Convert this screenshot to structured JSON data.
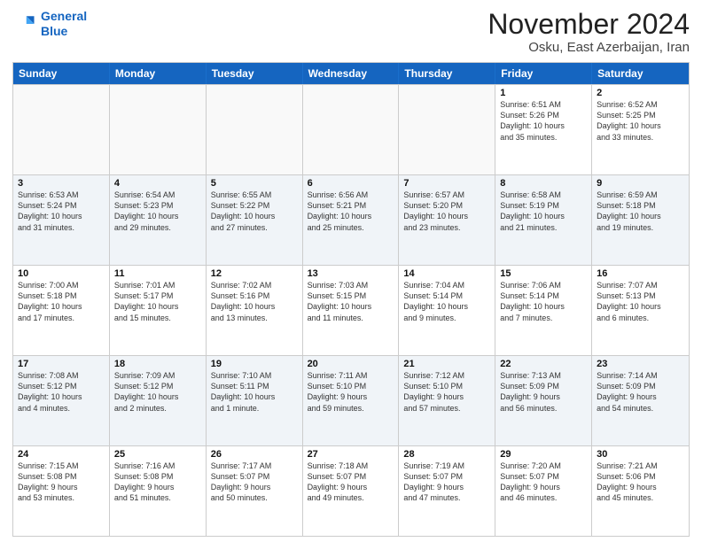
{
  "header": {
    "logo_line1": "General",
    "logo_line2": "Blue",
    "month_title": "November 2024",
    "location": "Osku, East Azerbaijan, Iran"
  },
  "weekdays": [
    "Sunday",
    "Monday",
    "Tuesday",
    "Wednesday",
    "Thursday",
    "Friday",
    "Saturday"
  ],
  "rows": [
    [
      {
        "day": "",
        "info": ""
      },
      {
        "day": "",
        "info": ""
      },
      {
        "day": "",
        "info": ""
      },
      {
        "day": "",
        "info": ""
      },
      {
        "day": "",
        "info": ""
      },
      {
        "day": "1",
        "info": "Sunrise: 6:51 AM\nSunset: 5:26 PM\nDaylight: 10 hours\nand 35 minutes."
      },
      {
        "day": "2",
        "info": "Sunrise: 6:52 AM\nSunset: 5:25 PM\nDaylight: 10 hours\nand 33 minutes."
      }
    ],
    [
      {
        "day": "3",
        "info": "Sunrise: 6:53 AM\nSunset: 5:24 PM\nDaylight: 10 hours\nand 31 minutes."
      },
      {
        "day": "4",
        "info": "Sunrise: 6:54 AM\nSunset: 5:23 PM\nDaylight: 10 hours\nand 29 minutes."
      },
      {
        "day": "5",
        "info": "Sunrise: 6:55 AM\nSunset: 5:22 PM\nDaylight: 10 hours\nand 27 minutes."
      },
      {
        "day": "6",
        "info": "Sunrise: 6:56 AM\nSunset: 5:21 PM\nDaylight: 10 hours\nand 25 minutes."
      },
      {
        "day": "7",
        "info": "Sunrise: 6:57 AM\nSunset: 5:20 PM\nDaylight: 10 hours\nand 23 minutes."
      },
      {
        "day": "8",
        "info": "Sunrise: 6:58 AM\nSunset: 5:19 PM\nDaylight: 10 hours\nand 21 minutes."
      },
      {
        "day": "9",
        "info": "Sunrise: 6:59 AM\nSunset: 5:18 PM\nDaylight: 10 hours\nand 19 minutes."
      }
    ],
    [
      {
        "day": "10",
        "info": "Sunrise: 7:00 AM\nSunset: 5:18 PM\nDaylight: 10 hours\nand 17 minutes."
      },
      {
        "day": "11",
        "info": "Sunrise: 7:01 AM\nSunset: 5:17 PM\nDaylight: 10 hours\nand 15 minutes."
      },
      {
        "day": "12",
        "info": "Sunrise: 7:02 AM\nSunset: 5:16 PM\nDaylight: 10 hours\nand 13 minutes."
      },
      {
        "day": "13",
        "info": "Sunrise: 7:03 AM\nSunset: 5:15 PM\nDaylight: 10 hours\nand 11 minutes."
      },
      {
        "day": "14",
        "info": "Sunrise: 7:04 AM\nSunset: 5:14 PM\nDaylight: 10 hours\nand 9 minutes."
      },
      {
        "day": "15",
        "info": "Sunrise: 7:06 AM\nSunset: 5:14 PM\nDaylight: 10 hours\nand 7 minutes."
      },
      {
        "day": "16",
        "info": "Sunrise: 7:07 AM\nSunset: 5:13 PM\nDaylight: 10 hours\nand 6 minutes."
      }
    ],
    [
      {
        "day": "17",
        "info": "Sunrise: 7:08 AM\nSunset: 5:12 PM\nDaylight: 10 hours\nand 4 minutes."
      },
      {
        "day": "18",
        "info": "Sunrise: 7:09 AM\nSunset: 5:12 PM\nDaylight: 10 hours\nand 2 minutes."
      },
      {
        "day": "19",
        "info": "Sunrise: 7:10 AM\nSunset: 5:11 PM\nDaylight: 10 hours\nand 1 minute."
      },
      {
        "day": "20",
        "info": "Sunrise: 7:11 AM\nSunset: 5:10 PM\nDaylight: 9 hours\nand 59 minutes."
      },
      {
        "day": "21",
        "info": "Sunrise: 7:12 AM\nSunset: 5:10 PM\nDaylight: 9 hours\nand 57 minutes."
      },
      {
        "day": "22",
        "info": "Sunrise: 7:13 AM\nSunset: 5:09 PM\nDaylight: 9 hours\nand 56 minutes."
      },
      {
        "day": "23",
        "info": "Sunrise: 7:14 AM\nSunset: 5:09 PM\nDaylight: 9 hours\nand 54 minutes."
      }
    ],
    [
      {
        "day": "24",
        "info": "Sunrise: 7:15 AM\nSunset: 5:08 PM\nDaylight: 9 hours\nand 53 minutes."
      },
      {
        "day": "25",
        "info": "Sunrise: 7:16 AM\nSunset: 5:08 PM\nDaylight: 9 hours\nand 51 minutes."
      },
      {
        "day": "26",
        "info": "Sunrise: 7:17 AM\nSunset: 5:07 PM\nDaylight: 9 hours\nand 50 minutes."
      },
      {
        "day": "27",
        "info": "Sunrise: 7:18 AM\nSunset: 5:07 PM\nDaylight: 9 hours\nand 49 minutes."
      },
      {
        "day": "28",
        "info": "Sunrise: 7:19 AM\nSunset: 5:07 PM\nDaylight: 9 hours\nand 47 minutes."
      },
      {
        "day": "29",
        "info": "Sunrise: 7:20 AM\nSunset: 5:07 PM\nDaylight: 9 hours\nand 46 minutes."
      },
      {
        "day": "30",
        "info": "Sunrise: 7:21 AM\nSunset: 5:06 PM\nDaylight: 9 hours\nand 45 minutes."
      }
    ]
  ]
}
